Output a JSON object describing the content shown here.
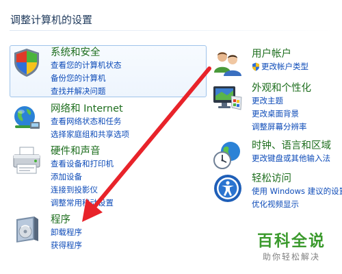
{
  "page_title": "调整计算机的设置",
  "categories": {
    "system_security": {
      "title": "系统和安全",
      "links": [
        "查看您的计算机状态",
        "备份您的计算机",
        "查找并解决问题"
      ],
      "icon": "shield-flag-icon"
    },
    "network": {
      "title": "网络和 Internet",
      "links": [
        "查看网络状态和任务",
        "选择家庭组和共享选项"
      ],
      "icon": "network-globe-icon"
    },
    "hardware": {
      "title": "硬件和声音",
      "links": [
        "查看设备和打印机",
        "添加设备",
        "连接到投影仪",
        "调整常用移动设置"
      ],
      "icon": "printer-icon"
    },
    "programs": {
      "title": "程序",
      "links": [
        "卸载程序",
        "获得程序"
      ],
      "icon": "programs-box-icon"
    },
    "user_accounts": {
      "title": "用户帐户",
      "links": [
        "更改帐户类型"
      ],
      "icon": "users-icon"
    },
    "appearance": {
      "title": "外观和个性化",
      "links": [
        "更改主题",
        "更改桌面背景",
        "调整屏幕分辨率"
      ],
      "icon": "monitor-palette-icon"
    },
    "clock": {
      "title": "时钟、语言和区域",
      "links": [
        "更改键盘或其他输入法"
      ],
      "icon": "clock-globe-icon"
    },
    "ease": {
      "title": "轻松访问",
      "links": [
        "使用 Windows 建议的设置",
        "优化视频显示"
      ],
      "icon": "ease-of-access-icon"
    }
  },
  "watermark": {
    "title": "百科全说",
    "subtitle": "助你轻松解决"
  },
  "colors": {
    "category_title": "#1e6e1e",
    "link": "#0d4bb8",
    "heading": "#1e395b",
    "arrow": "#e8232a",
    "watermark_green": "#3b9a2d"
  }
}
